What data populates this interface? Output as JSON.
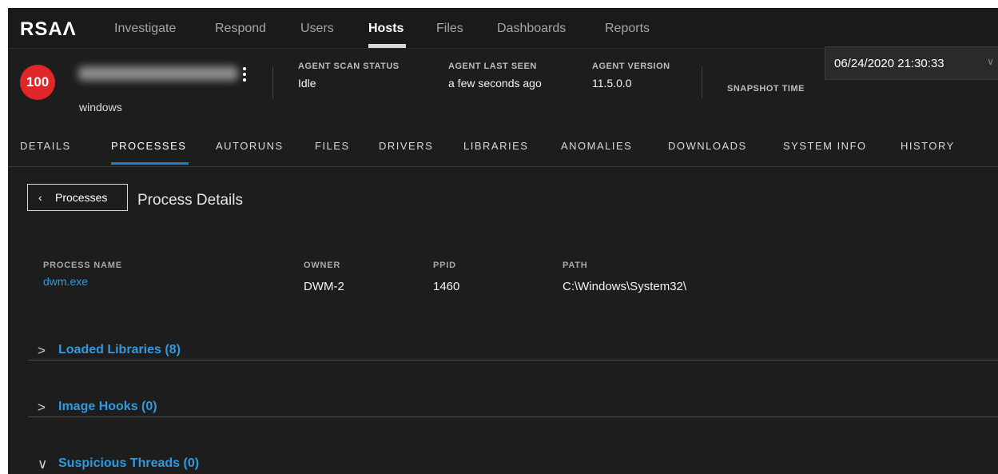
{
  "app": {
    "logo": "RSAΛ"
  },
  "nav": [
    {
      "label": "Investigate"
    },
    {
      "label": "Respond"
    },
    {
      "label": "Users"
    },
    {
      "label": "Hosts"
    },
    {
      "label": "Files"
    },
    {
      "label": "Dashboards"
    },
    {
      "label": "Reports"
    }
  ],
  "nav_active": "Hosts",
  "host": {
    "risk_score": "100",
    "os": "windows",
    "agent_scan_status_label": "AGENT SCAN STATUS",
    "agent_scan_status": "Idle",
    "agent_last_seen_label": "AGENT LAST SEEN",
    "agent_last_seen": "a few seconds ago",
    "agent_version_label": "AGENT VERSION",
    "agent_version": "11.5.0.0",
    "snapshot_label": "SNAPSHOT TIME",
    "snapshot_value": "06/24/2020 21:30:33",
    "snapshot_chevron": "∨"
  },
  "tabs": [
    {
      "label": "DETAILS"
    },
    {
      "label": "PROCESSES"
    },
    {
      "label": "AUTORUNS"
    },
    {
      "label": "FILES"
    },
    {
      "label": "DRIVERS"
    },
    {
      "label": "LIBRARIES"
    },
    {
      "label": "ANOMALIES"
    },
    {
      "label": "DOWNLOADS"
    },
    {
      "label": "SYSTEM INFO"
    },
    {
      "label": "HISTORY"
    }
  ],
  "tabs_active": "PROCESSES",
  "details": {
    "back_chevron": "‹",
    "back_label": "Processes",
    "title": "Process Details",
    "process_name_label": "PROCESS NAME",
    "process_name": "dwm.exe",
    "owner_label": "OWNER",
    "owner": "DWM-2",
    "ppid_label": "PPID",
    "ppid": "1460",
    "path_label": "PATH",
    "path": "C:\\Windows\\System32\\"
  },
  "sections": [
    {
      "chevron": ">",
      "title": "Loaded Libraries (8)"
    },
    {
      "chevron": ">",
      "title": "Image Hooks (0)"
    },
    {
      "chevron": "∨",
      "title": "Suspicious Threads (0)"
    }
  ],
  "colors": {
    "accent": "#1c7fd4",
    "link": "#2f9ae0",
    "risk": "#e02626",
    "background": "#1d1d1d"
  }
}
